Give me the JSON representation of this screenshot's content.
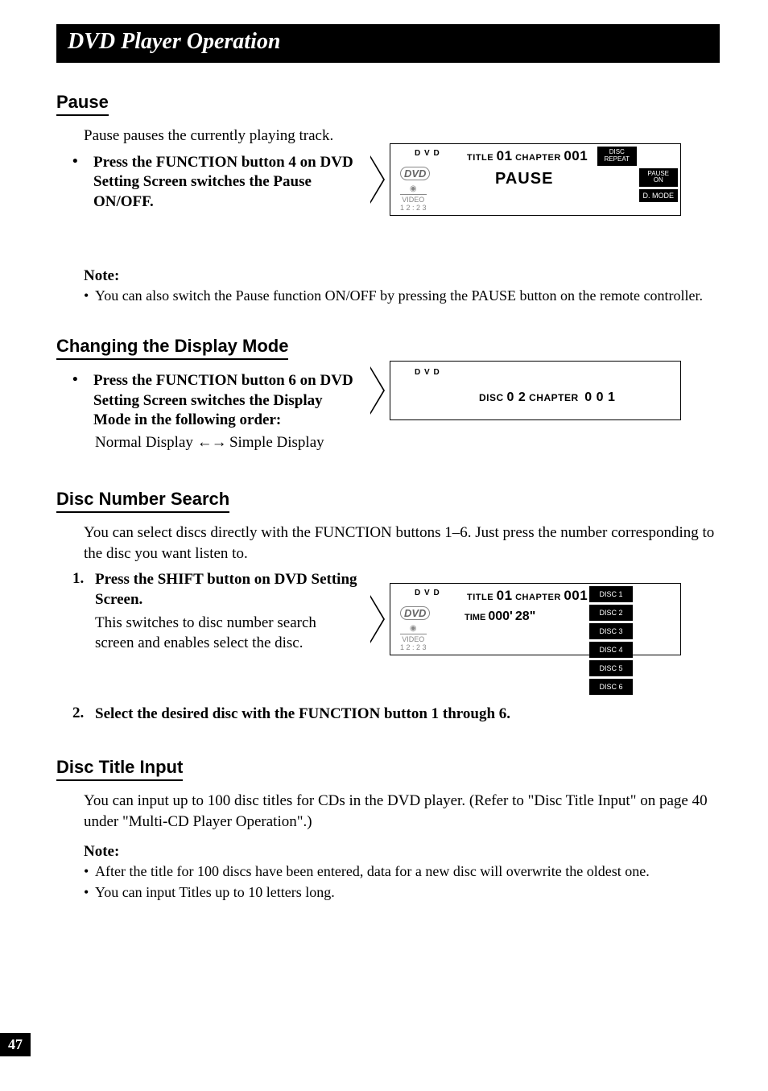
{
  "titleBar": "DVD Player Operation",
  "pause": {
    "heading": "Pause",
    "intro": "Pause pauses the currently playing track.",
    "instruction": "Press the FUNCTION button 4 on DVD Setting Screen switches the Pause ON/OFF.",
    "noteLabel": "Note:",
    "note1": "You can also switch the Pause function ON/OFF by pressing the PAUSE button on the remote controller."
  },
  "displayMode": {
    "heading": "Changing the Display Mode",
    "instruction": "Press the FUNCTION button 6 on DVD Setting Screen switches the Display Mode in the following order:",
    "order_left": "Normal Display",
    "order_right": "Simple Display"
  },
  "discSearch": {
    "heading": "Disc Number Search",
    "intro": "You can select discs directly with the FUNCTION buttons 1–6. Just press the number corresponding to the disc you want listen to.",
    "step1_num": "1.",
    "step1": "Press the SHIFT button on DVD Setting Screen.",
    "step1_sub": "This switches to disc number search screen and enables select the disc.",
    "step2_num": "2.",
    "step2": "Select the desired disc with the FUNCTION button 1 through 6."
  },
  "titleInput": {
    "heading": "Disc Title Input",
    "intro": "You can input up to 100 disc titles for CDs in the DVD player. (Refer to \"Disc Title Input\" on page 40 under \"Multi-CD Player Operation\".)",
    "noteLabel": "Note:",
    "note1": "After the title for 100 discs have been entered, data for a new disc will overwrite the oldest one.",
    "note2": "You can input Titles up to 10 letters long."
  },
  "screens": {
    "pause": {
      "dvd": "D V D",
      "titleChap_a": "TITLE",
      "titleChap_b": "01",
      "titleChap_c": "CHAPTER",
      "titleChap_d": "001",
      "centerText": "PAUSE",
      "dvdLogo": "DVD",
      "videoLabel": "VIDEO",
      "timecode": "1 2 : 2 3",
      "btn_discrepeat": "DISC\nREPEAT",
      "btn_pause": "PAUSE\nON",
      "btn_dmode": "D. MODE"
    },
    "simple": {
      "dvd": "D V D",
      "text_a": "DISC",
      "text_b": "0 2",
      "text_c": "CHAPTER",
      "text_d": "0 0 1"
    },
    "discsearch": {
      "dvd": "D V D",
      "titleChap_a": "TITLE",
      "titleChap_b": "01",
      "titleChap_c": "CHAPTER",
      "titleChap_d": "001",
      "time_a": "TIME",
      "time_b": "000'",
      "time_c": "28\"",
      "dvdLogo": "DVD",
      "videoLabel": "VIDEO",
      "timecode": "1 2 : 2 3",
      "d1": "DISC 1",
      "d2": "DISC 2",
      "d3": "DISC 3",
      "d4": "DISC 4",
      "d5": "DISC 5",
      "d6": "DISC 6"
    }
  },
  "pageNumber": "47"
}
